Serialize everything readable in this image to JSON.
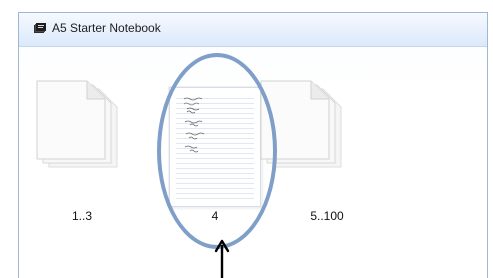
{
  "window": {
    "title": "A5 Starter Notebook"
  },
  "icons": {
    "notebook": "book-icon",
    "page_stack": "page-stack-icon",
    "page_thumbnail": "page-thumbnail-icon",
    "arrow": "arrow-icon"
  },
  "pages": [
    {
      "label": "1..3"
    },
    {
      "label": "4"
    },
    {
      "label": "5..100"
    }
  ]
}
